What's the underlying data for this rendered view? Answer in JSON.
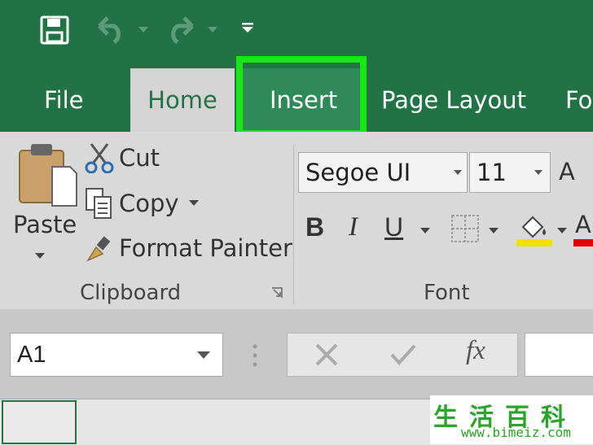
{
  "tabs": {
    "file": "File",
    "home": "Home",
    "insert": "Insert",
    "page_layout": "Page Layout",
    "formulas_partial": "Fo"
  },
  "clipboard": {
    "paste": "Paste",
    "cut": "Cut",
    "copy": "Copy",
    "format_painter": "Format Painter",
    "group_label": "Clipboard"
  },
  "font": {
    "name": "Segoe UI",
    "size": "11",
    "grow_partial": "A",
    "bold": "B",
    "italic": "I",
    "underline": "U",
    "group_label": "Font",
    "font_color_partial": "A"
  },
  "formula_bar": {
    "name_box": "A1",
    "fx": "fx"
  },
  "watermark": {
    "chinese": "生活百科",
    "url": "www.bimeiz.com"
  },
  "colors": {
    "excel_green": "#217346",
    "highlight_green": "#19e619",
    "fill_yellow": "#f0e000",
    "font_red": "#e00000"
  },
  "icons": [
    "save-icon",
    "undo-icon",
    "redo-icon",
    "customize-qat-icon",
    "paste-icon",
    "cut-icon",
    "copy-icon",
    "format-painter-icon",
    "borders-icon",
    "fill-color-icon",
    "dialog-launcher-icon",
    "cancel-icon",
    "enter-icon"
  ]
}
